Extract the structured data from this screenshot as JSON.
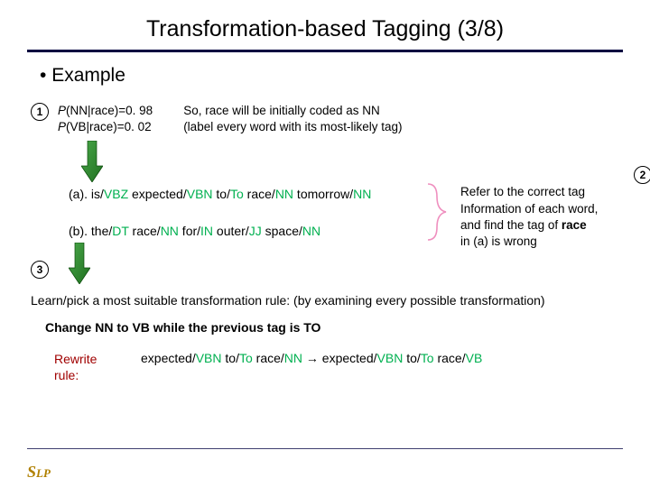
{
  "title": "Transformation-based Tagging (3/8)",
  "bullet": "Example",
  "step1": {
    "num": "1",
    "p1_pre": "P",
    "p1_body": "(NN|race)=0. 98",
    "p2_pre": "P",
    "p2_body": "(VB|race)=0. 02",
    "so1": "So, race will be initially coded as NN",
    "so2": "(label every word with its most-likely tag)"
  },
  "examples": {
    "a_pre": "(a).  is/",
    "a_t1": "VBZ",
    "a_mid1": " expected/",
    "a_t2": "VBN",
    "a_mid2": "  to/",
    "a_t3": "To",
    "a_mid3": " race/",
    "a_t4": "NN",
    "a_mid4": " tomorrow/",
    "a_t5": "NN",
    "b_pre": "(b).  the/",
    "b_t1": "DT",
    "b_mid1": " race/",
    "b_t2": "NN",
    "b_mid2": " for/",
    "b_t3": "IN",
    "b_mid3": " outer/",
    "b_t4": "JJ",
    "b_mid4": " space/",
    "b_t5": "NN"
  },
  "step2": {
    "num": "2",
    "l1": "Refer to the correct tag",
    "l2": "Information of each word,",
    "l3_pre": "and find the tag of ",
    "l3_b": "race",
    "l4": "in (a) is wrong"
  },
  "step3": {
    "num": "3",
    "learn": "Learn/pick a most suitable transformation rule: (by examining every possible transformation)",
    "rule": "Change NN to VB while the previous tag is TO",
    "rewrite_label1": "Rewrite",
    "rewrite_label2": "rule:",
    "rw_1": "expected/",
    "rw_t1": "VBN",
    "rw_2": "  to/",
    "rw_t2": "To",
    "rw_3": " race/",
    "rw_t3": "NN",
    "rw_arrow": " → expected/",
    "rw_t4": "VBN",
    "rw_4": "  to/",
    "rw_t5": "To",
    "rw_5": " race/",
    "rw_t6": "VB"
  },
  "logo": {
    "s": "S",
    "lp": "LP"
  }
}
